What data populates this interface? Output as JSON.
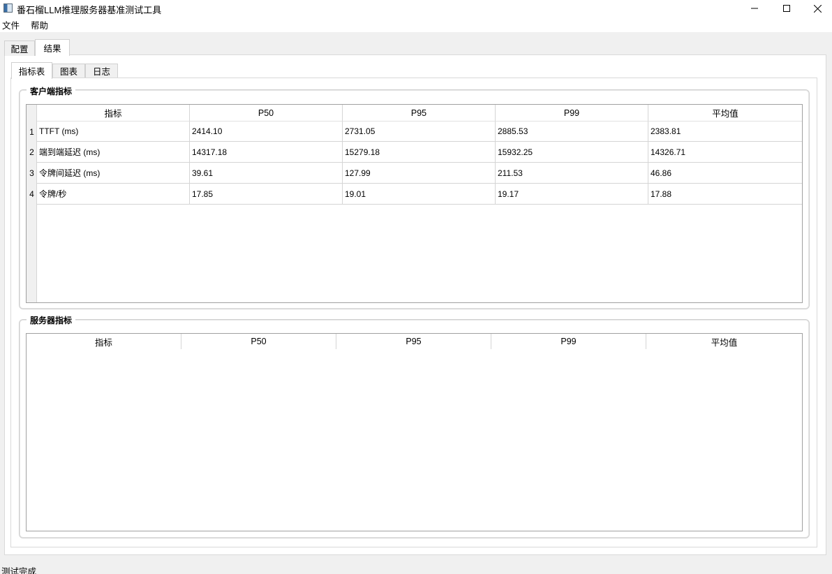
{
  "window": {
    "title": "番石榴LLM推理服务器基准测试工具",
    "controls": [
      "minimize-icon",
      "maximize-icon",
      "close-icon"
    ]
  },
  "menu": {
    "items": [
      "文件",
      "帮助"
    ]
  },
  "outer_tabs": {
    "items": [
      "配置",
      "结果"
    ],
    "active": "结果"
  },
  "inner_tabs": {
    "items": [
      "指标表",
      "图表",
      "日志"
    ],
    "active": "指标表"
  },
  "client_metrics": {
    "title": "客户端指标",
    "headers": [
      "指标",
      "P50",
      "P95",
      "P99",
      "平均值"
    ],
    "rows": [
      {
        "num": "1",
        "cells": [
          "TTFT (ms)",
          "2414.10",
          "2731.05",
          "2885.53",
          "2383.81"
        ]
      },
      {
        "num": "2",
        "cells": [
          "端到端延迟 (ms)",
          "14317.18",
          "15279.18",
          "15932.25",
          "14326.71"
        ]
      },
      {
        "num": "3",
        "cells": [
          "令牌间延迟 (ms)",
          "39.61",
          "127.99",
          "211.53",
          "46.86"
        ]
      },
      {
        "num": "4",
        "cells": [
          "令牌/秒",
          "17.85",
          "19.01",
          "19.17",
          "17.88"
        ]
      }
    ]
  },
  "server_metrics": {
    "title": "服务器指标",
    "headers": [
      "指标",
      "P50",
      "P95",
      "P99",
      "平均值"
    ],
    "rows": []
  },
  "status": {
    "text": "测试完成"
  }
}
